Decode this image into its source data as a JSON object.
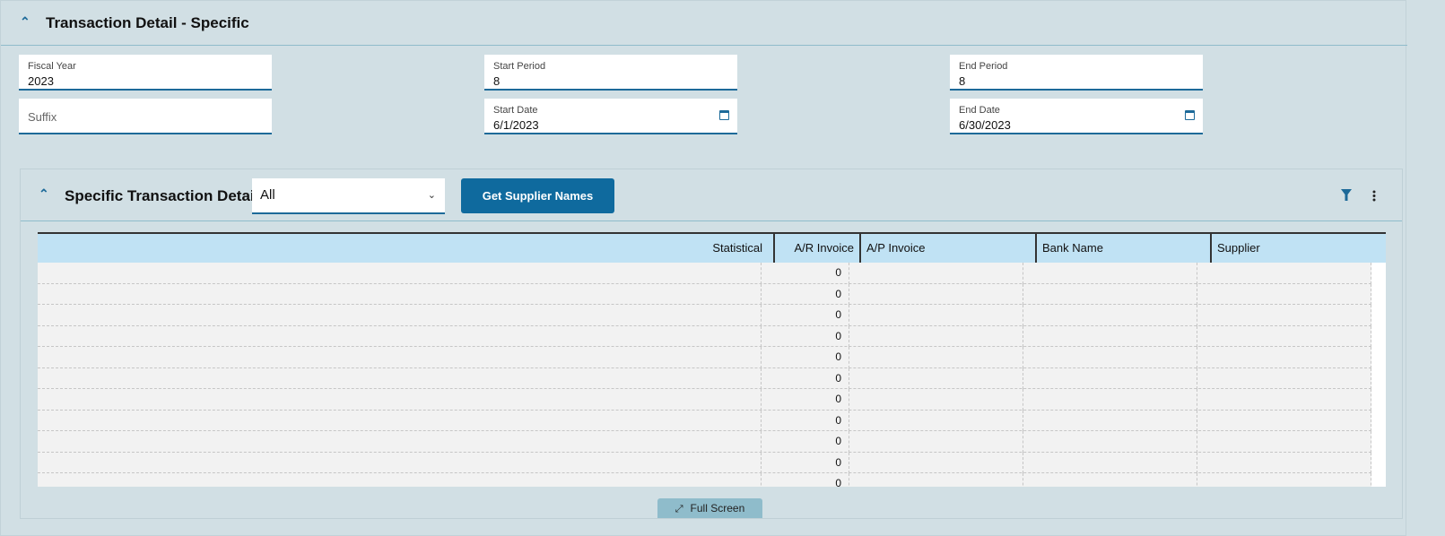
{
  "section": {
    "title": "Transaction Detail - Specific"
  },
  "fields": {
    "fiscal_year": {
      "label": "Fiscal Year",
      "value": "2023"
    },
    "start_period": {
      "label": "Start Period",
      "value": "8"
    },
    "end_period": {
      "label": "End Period",
      "value": "8"
    },
    "suffix": {
      "placeholder": "Suffix"
    },
    "start_date": {
      "label": "Start Date",
      "value": "6/1/2023"
    },
    "end_date": {
      "label": "End Date",
      "value": "6/30/2023"
    }
  },
  "panel": {
    "title": "Specific Transaction Detail",
    "filter_value": "All",
    "button": "Get Supplier Names",
    "full_screen": "Full Screen"
  },
  "grid": {
    "columns": [
      "Statistical",
      "A/R Invoice",
      "A/P Invoice",
      "Bank Name",
      "Supplier"
    ],
    "rows": [
      [
        "",
        "0",
        "",
        "",
        ""
      ],
      [
        "",
        "0",
        "",
        "",
        ""
      ],
      [
        "",
        "0",
        "",
        "",
        ""
      ],
      [
        "",
        "0",
        "",
        "",
        ""
      ],
      [
        "",
        "0",
        "",
        "",
        ""
      ],
      [
        "",
        "0",
        "",
        "",
        ""
      ],
      [
        "",
        "0",
        "",
        "",
        ""
      ],
      [
        "",
        "0",
        "",
        "",
        ""
      ],
      [
        "",
        "0",
        "",
        "",
        ""
      ],
      [
        "",
        "0",
        "",
        "",
        ""
      ],
      [
        "",
        "0",
        "",
        "",
        ""
      ]
    ]
  }
}
